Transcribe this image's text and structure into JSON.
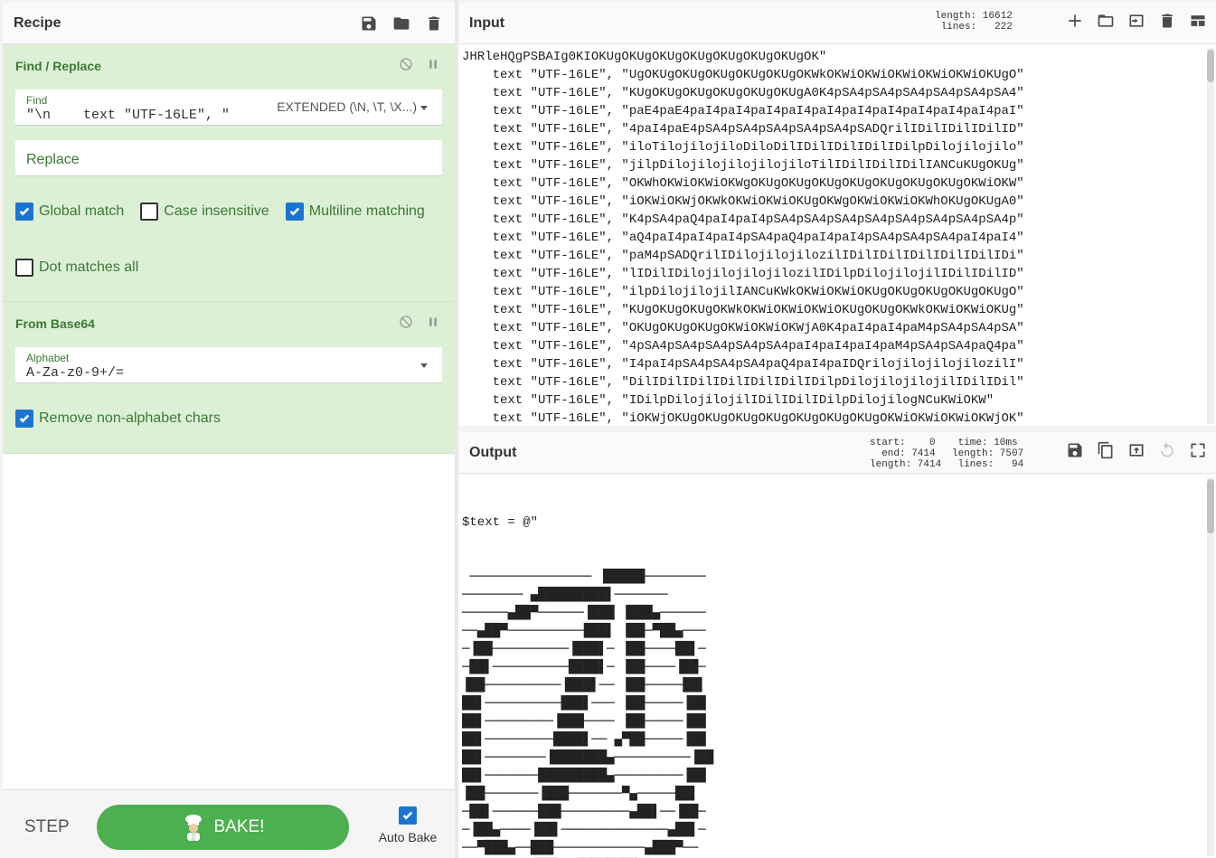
{
  "recipe": {
    "title": "Recipe",
    "operations": [
      {
        "title": "Find / Replace",
        "find_label": "Find",
        "find_value": "\"\\n    text \"UTF-16LE\", \"",
        "find_mode": "EXTENDED (\\N, \\T, \\X...)",
        "replace_placeholder": "Replace",
        "checks": [
          {
            "label": "Global match",
            "checked": true
          },
          {
            "label": "Case insensitive",
            "checked": false
          },
          {
            "label": "Multiline matching",
            "checked": true
          },
          {
            "label": "Dot matches all",
            "checked": false
          }
        ]
      },
      {
        "title": "From Base64",
        "alphabet_label": "Alphabet",
        "alphabet_value": "A-Za-z0-9+/=",
        "checks": [
          {
            "label": "Remove non-alphabet chars",
            "checked": true
          }
        ]
      }
    ],
    "step_label": "STEP",
    "bake_label": "BAKE!",
    "autobake_label": "Auto Bake"
  },
  "input": {
    "title": "Input",
    "stats": "length: 16612\n lines:   222",
    "lines": [
      "JHRleHQgPSBAIg0KIOKUgOKUgOKUgOKUgOKUgOKUgOKUgOK\"",
      "    text \"UTF-16LE\", \"UgOKUgOKUgOKUgOKUgOKUgOKWkOKWiOKWiOKWiOKWiOKWiOKUgO\"",
      "    text \"UTF-16LE\", \"KUgOKUgOKUgOKUgOKUgOKUgA0K4pSA4pSA4pSA4pSA4pSA4pSA4\"",
      "    text \"UTF-16LE\", \"paE4paE4paI4paI4paI4paI4paI4paI4paI4paI4paI4paI4paI\"",
      "    text \"UTF-16LE\", \"4paI4paE4pSA4pSA4pSA4pSA4pSA4pSADQrilIDilIDilIDilID\"",
      "    text \"UTF-16LE\", \"iloTilojilojiloDiloDilIDilIDilIDilIDilpDilojilojilo\"",
      "    text \"UTF-16LE\", \"jilpDilojilojilojilojiloTilIDilIDilIDilIANCuKUgOKUg\"",
      "    text \"UTF-16LE\", \"OKWhOKWiOKWiOKWgOKUgOKUgOKUgOKUgOKUgOKUgOKUgOKWiOKW\"",
      "    text \"UTF-16LE\", \"iOKWiOKWjOKWkOKWiOKWiOKUgOKWgOKWiOKWiOKWhOKUgOKUgA0\"",
      "    text \"UTF-16LE\", \"K4pSA4paQ4paI4paI4pSA4pSA4pSA4pSA4pSA4pSA4pSA4pSA4p\"",
      "    text \"UTF-16LE\", \"aQ4paI4paI4paI4pSA4paQ4paI4paI4pSA4pSA4pSA4paI4paI4\"",
      "    text \"UTF-16LE\", \"paM4pSADQrilIDilojilojilozilIDilIDilIDilIDilIDilIDi\"",
      "    text \"UTF-16LE\", \"lIDilIDilojilojilojilozilIDilpDilojilojilIDilIDilID\"",
      "    text \"UTF-16LE\", \"ilpDilojilojilIANCuKWkOKWiOKWiOKUgOKUgOKUgOKUgOKUgO\"",
      "    text \"UTF-16LE\", \"KUgOKUgOKUgOKWkOKWiOKWiOKWiOKUgOKUgOKWkOKWiOKWiOKUg\"",
      "    text \"UTF-16LE\", \"OKUgOKUgOKUgOKWiOKWiOKWjA0K4paI4paI4paM4pSA4pSA4pSA\"",
      "    text \"UTF-16LE\", \"4pSA4pSA4pSA4pSA4pSA4paI4paI4paI4paM4pSA4pSA4paQ4pa\"",
      "    text \"UTF-16LE\", \"I4paI4pSA4pSA4pSA4paQ4paI4paIDQrilojilojilojilozilI\"",
      "    text \"UTF-16LE\", \"DilIDilIDilIDilIDilIDilIDilpDilojilojilojilIDilIDil\"",
      "    text \"UTF-16LE\", \"IDilpDilojilojilIDilIDilIDilpDilojilogNCuKWiOKW\"",
      "    text \"UTF-16LE\", \"iOKWjOKUgOKUgOKUgOKUgOKUgOKUgOKUgOKWiOKWiOKWiOKWjOK\""
    ]
  },
  "output": {
    "title": "Output",
    "stats_left": "start:    0\n  end: 7414\nlength: 7414",
    "stats_right": " time: 10ms\nlength: 7507\n lines:   94",
    "first_line": "$text = @\"",
    "art": [
      " ──────────────── ▐█████────────",
      "──────── ▄█████████▌───────",
      "──────▄██▀──────▐███ ▐███▄──────",
      "──▄██▀──────────███▌ ▐██─▀██▄───",
      "─▐██──────────▐███▌─ ▐██────██▌─",
      "─██▌──────────████▌─ ▐██────▐██─",
      "▐██──────────▐███▌── ▐██─────██▌",
      "██▌──────────███▌─── ▐██─────▐██",
      "██▌─────────▐███──── ▐██─────▐██",
      "██▌─────────████▌── ▄▀██─────▐██",
      "██▌────────▐███████▄──────────▐██",
      "██▌───────█████████▄─────────▐██",
      "▐██───────▐███───────▀▄─────██▌",
      "─██▌──────███─────────▄██▌──▐██─",
      "─▐██▄────▐██▌──────────────▄██▌─",
      "──▀███▄──███────────────▄███▀──",
      "──────── ▐██▌─▄████████▀▀────────",
      "───────██───────────────────────"
    ]
  }
}
